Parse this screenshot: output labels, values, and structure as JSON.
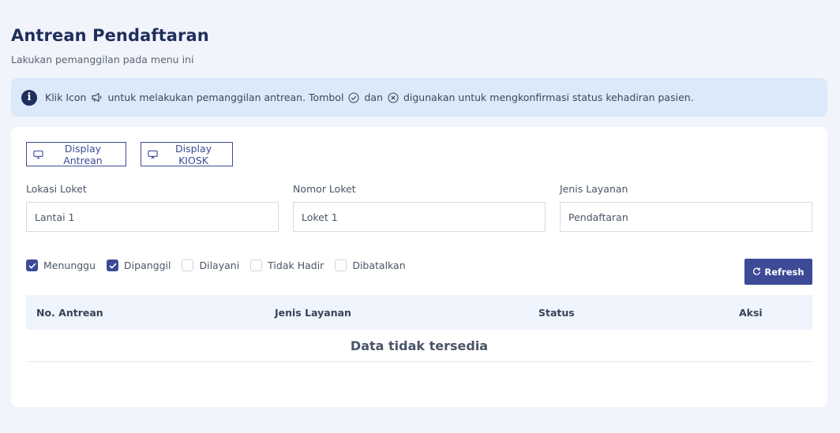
{
  "header": {
    "title": "Antrean Pendaftaran",
    "subtitle": "Lakukan pemanggilan pada menu ini"
  },
  "alert": {
    "icon": "info-icon",
    "text_before": "Klik Icon",
    "text_after_call_icon": "untuk melakukan pemanggilan antrean. Tombol",
    "text_between": "dan",
    "text_end": "digunakan untuk mengkonfirmasi status kehadiran pasien."
  },
  "buttons": {
    "display_antrean": "Display Antrean",
    "display_kiosk": "Display KIOSK",
    "refresh": "Refresh"
  },
  "fields": {
    "lokasi_loket": {
      "label": "Lokasi Loket",
      "value": "Lantai 1"
    },
    "nomor_loket": {
      "label": "Nomor Loket",
      "value": "Loket 1"
    },
    "jenis_layanan": {
      "label": "Jenis Layanan",
      "value": "Pendaftaran"
    }
  },
  "filters": [
    {
      "label": "Menunggu",
      "checked": true
    },
    {
      "label": "Dipanggil",
      "checked": true
    },
    {
      "label": "Dilayani",
      "checked": false
    },
    {
      "label": "Tidak Hadir",
      "checked": false
    },
    {
      "label": "Dibatalkan",
      "checked": false
    }
  ],
  "table": {
    "columns": [
      "No. Antrean",
      "Jenis Layanan",
      "Status",
      "Aksi"
    ],
    "empty_message": "Data tidak tersedia"
  },
  "colors": {
    "primary": "#3d4a96",
    "title": "#1f2f5c",
    "alert_bg": "#dce9fb",
    "page_bg": "#f1f4fb"
  }
}
